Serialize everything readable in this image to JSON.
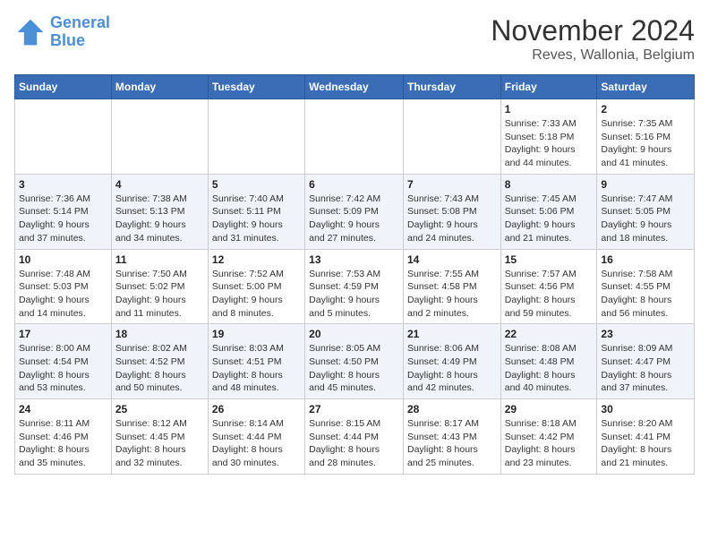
{
  "logo": {
    "line1": "General",
    "line2": "Blue"
  },
  "title": "November 2024",
  "subtitle": "Reves, Wallonia, Belgium",
  "headers": [
    "Sunday",
    "Monday",
    "Tuesday",
    "Wednesday",
    "Thursday",
    "Friday",
    "Saturday"
  ],
  "weeks": [
    [
      {
        "day": "",
        "info": ""
      },
      {
        "day": "",
        "info": ""
      },
      {
        "day": "",
        "info": ""
      },
      {
        "day": "",
        "info": ""
      },
      {
        "day": "",
        "info": ""
      },
      {
        "day": "1",
        "info": "Sunrise: 7:33 AM\nSunset: 5:18 PM\nDaylight: 9 hours\nand 44 minutes."
      },
      {
        "day": "2",
        "info": "Sunrise: 7:35 AM\nSunset: 5:16 PM\nDaylight: 9 hours\nand 41 minutes."
      }
    ],
    [
      {
        "day": "3",
        "info": "Sunrise: 7:36 AM\nSunset: 5:14 PM\nDaylight: 9 hours\nand 37 minutes."
      },
      {
        "day": "4",
        "info": "Sunrise: 7:38 AM\nSunset: 5:13 PM\nDaylight: 9 hours\nand 34 minutes."
      },
      {
        "day": "5",
        "info": "Sunrise: 7:40 AM\nSunset: 5:11 PM\nDaylight: 9 hours\nand 31 minutes."
      },
      {
        "day": "6",
        "info": "Sunrise: 7:42 AM\nSunset: 5:09 PM\nDaylight: 9 hours\nand 27 minutes."
      },
      {
        "day": "7",
        "info": "Sunrise: 7:43 AM\nSunset: 5:08 PM\nDaylight: 9 hours\nand 24 minutes."
      },
      {
        "day": "8",
        "info": "Sunrise: 7:45 AM\nSunset: 5:06 PM\nDaylight: 9 hours\nand 21 minutes."
      },
      {
        "day": "9",
        "info": "Sunrise: 7:47 AM\nSunset: 5:05 PM\nDaylight: 9 hours\nand 18 minutes."
      }
    ],
    [
      {
        "day": "10",
        "info": "Sunrise: 7:48 AM\nSunset: 5:03 PM\nDaylight: 9 hours\nand 14 minutes."
      },
      {
        "day": "11",
        "info": "Sunrise: 7:50 AM\nSunset: 5:02 PM\nDaylight: 9 hours\nand 11 minutes."
      },
      {
        "day": "12",
        "info": "Sunrise: 7:52 AM\nSunset: 5:00 PM\nDaylight: 9 hours\nand 8 minutes."
      },
      {
        "day": "13",
        "info": "Sunrise: 7:53 AM\nSunset: 4:59 PM\nDaylight: 9 hours\nand 5 minutes."
      },
      {
        "day": "14",
        "info": "Sunrise: 7:55 AM\nSunset: 4:58 PM\nDaylight: 9 hours\nand 2 minutes."
      },
      {
        "day": "15",
        "info": "Sunrise: 7:57 AM\nSunset: 4:56 PM\nDaylight: 8 hours\nand 59 minutes."
      },
      {
        "day": "16",
        "info": "Sunrise: 7:58 AM\nSunset: 4:55 PM\nDaylight: 8 hours\nand 56 minutes."
      }
    ],
    [
      {
        "day": "17",
        "info": "Sunrise: 8:00 AM\nSunset: 4:54 PM\nDaylight: 8 hours\nand 53 minutes."
      },
      {
        "day": "18",
        "info": "Sunrise: 8:02 AM\nSunset: 4:52 PM\nDaylight: 8 hours\nand 50 minutes."
      },
      {
        "day": "19",
        "info": "Sunrise: 8:03 AM\nSunset: 4:51 PM\nDaylight: 8 hours\nand 48 minutes."
      },
      {
        "day": "20",
        "info": "Sunrise: 8:05 AM\nSunset: 4:50 PM\nDaylight: 8 hours\nand 45 minutes."
      },
      {
        "day": "21",
        "info": "Sunrise: 8:06 AM\nSunset: 4:49 PM\nDaylight: 8 hours\nand 42 minutes."
      },
      {
        "day": "22",
        "info": "Sunrise: 8:08 AM\nSunset: 4:48 PM\nDaylight: 8 hours\nand 40 minutes."
      },
      {
        "day": "23",
        "info": "Sunrise: 8:09 AM\nSunset: 4:47 PM\nDaylight: 8 hours\nand 37 minutes."
      }
    ],
    [
      {
        "day": "24",
        "info": "Sunrise: 8:11 AM\nSunset: 4:46 PM\nDaylight: 8 hours\nand 35 minutes."
      },
      {
        "day": "25",
        "info": "Sunrise: 8:12 AM\nSunset: 4:45 PM\nDaylight: 8 hours\nand 32 minutes."
      },
      {
        "day": "26",
        "info": "Sunrise: 8:14 AM\nSunset: 4:44 PM\nDaylight: 8 hours\nand 30 minutes."
      },
      {
        "day": "27",
        "info": "Sunrise: 8:15 AM\nSunset: 4:44 PM\nDaylight: 8 hours\nand 28 minutes."
      },
      {
        "day": "28",
        "info": "Sunrise: 8:17 AM\nSunset: 4:43 PM\nDaylight: 8 hours\nand 25 minutes."
      },
      {
        "day": "29",
        "info": "Sunrise: 8:18 AM\nSunset: 4:42 PM\nDaylight: 8 hours\nand 23 minutes."
      },
      {
        "day": "30",
        "info": "Sunrise: 8:20 AM\nSunset: 4:41 PM\nDaylight: 8 hours\nand 21 minutes."
      }
    ]
  ]
}
